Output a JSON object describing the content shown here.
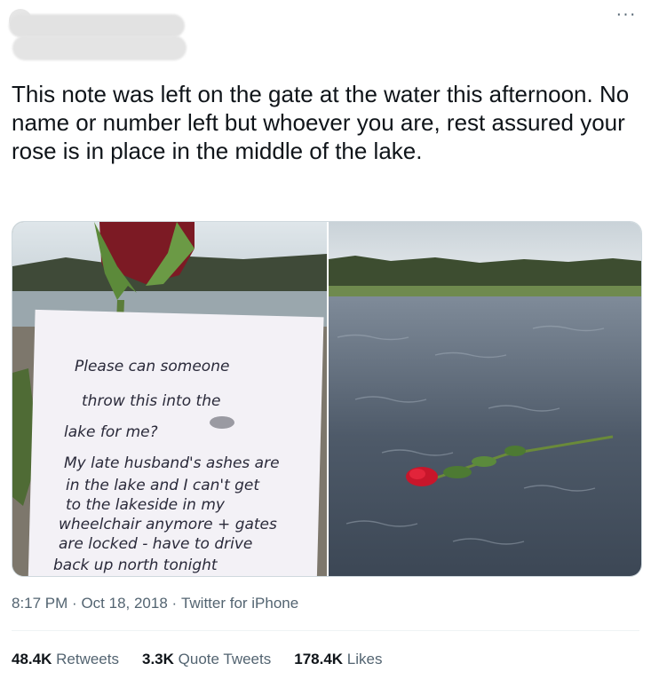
{
  "tweet": {
    "more_icon": "more-horizontal-icon",
    "text": "This note was left on the gate at the water this afternoon. No name or number left but whoever you are, rest assured your rose is in place in the middle of the lake.",
    "note_lines": [
      "Please can someone",
      "throw this into the",
      "lake for me?",
      "My late husband's ashes are",
      "in the lake and I can't get",
      "to the lakeside in my",
      "wheelchair anymore + gates",
      "are locked - have to drive",
      "back up north tonight"
    ],
    "time": "8:17 PM",
    "date": "Oct 18, 2018",
    "source": "Twitter for iPhone",
    "separator": "·",
    "retweets_count": "48.4K",
    "retweets_label": "Retweets",
    "quotes_count": "3.3K",
    "quotes_label": "Quote Tweets",
    "likes_count": "178.4K",
    "likes_label": "Likes"
  }
}
